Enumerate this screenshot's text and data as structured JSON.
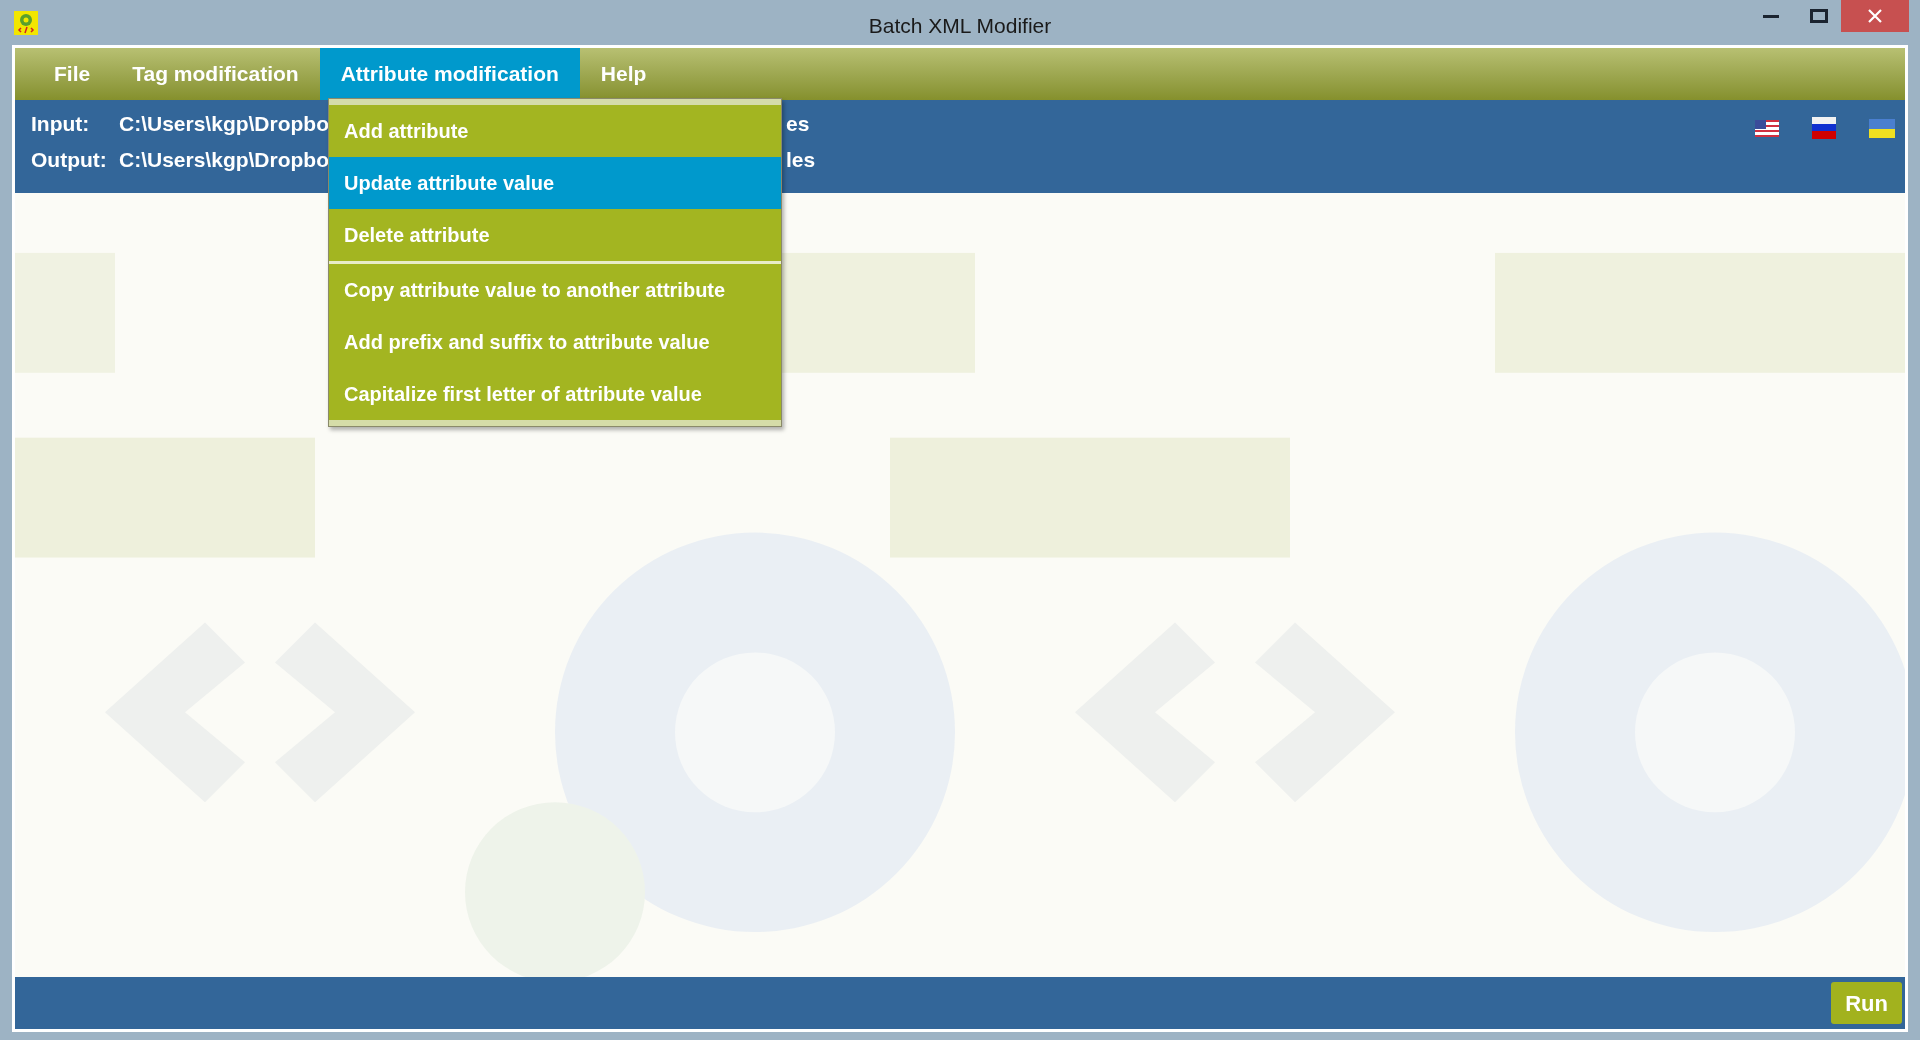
{
  "window": {
    "title": "Batch XML Modifier"
  },
  "menu_bar": [
    {
      "label": "File",
      "selected": false
    },
    {
      "label": "Tag modification",
      "selected": false
    },
    {
      "label": "Attribute modification",
      "selected": true
    },
    {
      "label": "Help",
      "selected": false
    }
  ],
  "paths": [
    {
      "label": "Input:",
      "value_start": "C:\\Users\\kgp\\Dropbo",
      "value_end": "es"
    },
    {
      "label": "Output:",
      "value_start": "C:\\Users\\kgp\\Dropbo",
      "value_end": "les"
    }
  ],
  "languages": [
    {
      "kind": "us"
    },
    {
      "kind": "ru"
    },
    {
      "kind": "ua"
    }
  ],
  "dropdown": {
    "groups": [
      [
        {
          "label": "Add attribute",
          "selected": false
        },
        {
          "label": "Update attribute value",
          "selected": true
        },
        {
          "label": "Delete attribute",
          "selected": false
        }
      ],
      [
        {
          "label": "Copy attribute value to another attribute",
          "selected": false
        },
        {
          "label": "Add prefix and suffix to attribute value",
          "selected": false
        },
        {
          "label": "Capitalize first letter of attribute value",
          "selected": false
        }
      ]
    ]
  },
  "run_button": "Run"
}
